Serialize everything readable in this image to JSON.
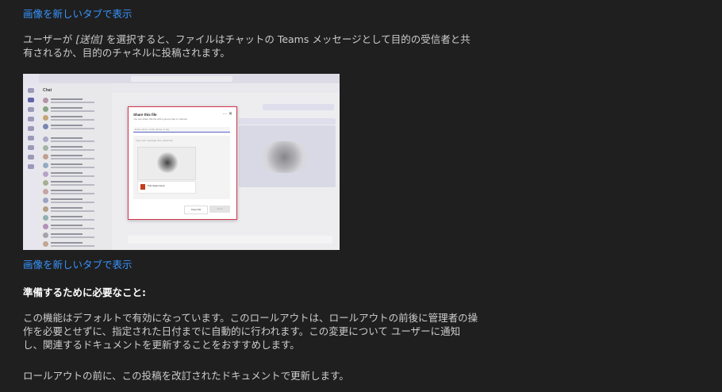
{
  "link_top": "画像を新しいタブで表示",
  "para1_before": "ユーザーが ",
  "para1_em": "[送信]",
  "para1_after": " を選択すると、ファイルはチャットの Teams メッセージとして目的の受信者と共有されるか、目的のチャネルに投稿されます。",
  "screenshot": {
    "dialog_title": "Share this file",
    "dialog_subtitle": "You can share this file with a group chat or channel",
    "dialog_input_placeholder": "Enter name, email, group, or tag",
    "dialog_message_placeholder": "Type your message here (optional)",
    "dialog_file_name": "Pub Sales Deck",
    "copy_link_label": "Copy link",
    "send_label": "Send",
    "chat_header": "Chat"
  },
  "link_bottom": "画像を新しいタブで表示",
  "heading": "準備するために必要なこと:",
  "para2": "この機能はデフォルトで有効になっています。このロールアウトは、ロールアウトの前後に管理者の操作を必要とせずに、指定された日付までに自動的に行われます。この変更について ユーザーに通知し、関連するドキュメントを更新することをおすすめします。",
  "para3": "ロールアウトの前に、この投稿を改訂されたドキュメントで更新します。",
  "colors": {
    "background": "#1f1f1f",
    "link": "#3794ff",
    "text": "#cccccc",
    "dialog_border": "#d5344d"
  }
}
